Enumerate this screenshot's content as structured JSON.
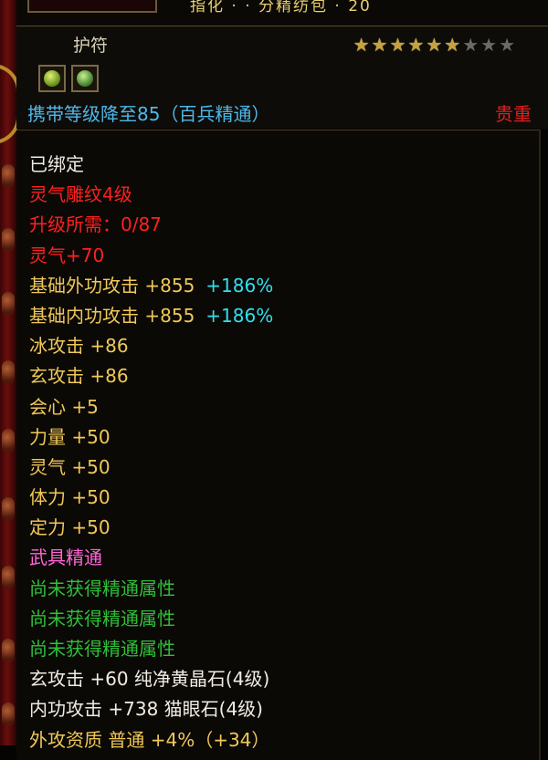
{
  "top": {
    "cut_text": "指化 · · 分精纺包 · 20"
  },
  "item": {
    "name": "护符",
    "stars_filled": 6,
    "stars_total": 9,
    "requirement": "携带等级降至85（百兵精通）",
    "rarity": "贵重"
  },
  "lines": [
    {
      "text": "已绑定",
      "color": "white"
    },
    {
      "text": "灵气雕纹4级",
      "color": "red"
    },
    {
      "text": "升级所需：0/87",
      "color": "red"
    },
    {
      "text": "灵气+70",
      "color": "red"
    },
    {
      "text": "基础外功攻击 +855",
      "extra": "+186%",
      "color": "gold"
    },
    {
      "text": "基础内功攻击 +855",
      "extra": "+186%",
      "color": "gold"
    },
    {
      "text": "冰攻击 +86",
      "color": "gold"
    },
    {
      "text": "玄攻击 +86",
      "color": "gold"
    },
    {
      "text": "会心 +5",
      "color": "gold"
    },
    {
      "text": "力量 +50",
      "color": "gold"
    },
    {
      "text": "灵气 +50",
      "color": "gold"
    },
    {
      "text": "体力 +50",
      "color": "gold"
    },
    {
      "text": "定力 +50",
      "color": "gold"
    },
    {
      "text": "武具精通",
      "color": "pink"
    },
    {
      "text": "尚未获得精通属性",
      "color": "green"
    },
    {
      "text": "尚未获得精通属性",
      "color": "green"
    },
    {
      "text": "尚未获得精通属性",
      "color": "green"
    },
    {
      "text": "玄攻击 +60 纯净黄晶石(4级)",
      "color": "white-gold"
    },
    {
      "text": "内功攻击 +738 猫眼石(4级)",
      "color": "white-gold"
    },
    {
      "text": "外攻资质 普通 +4%（+34）",
      "color": "gold"
    }
  ],
  "colors": {
    "white": "#f0ece4",
    "red": "#ff2020",
    "gold": "#f0c85a",
    "cyan": "#30e0f0",
    "pink": "#ff66d8",
    "green": "#2fbf3a",
    "requirement": "#4fb8e8",
    "rarity": "#e02020"
  }
}
